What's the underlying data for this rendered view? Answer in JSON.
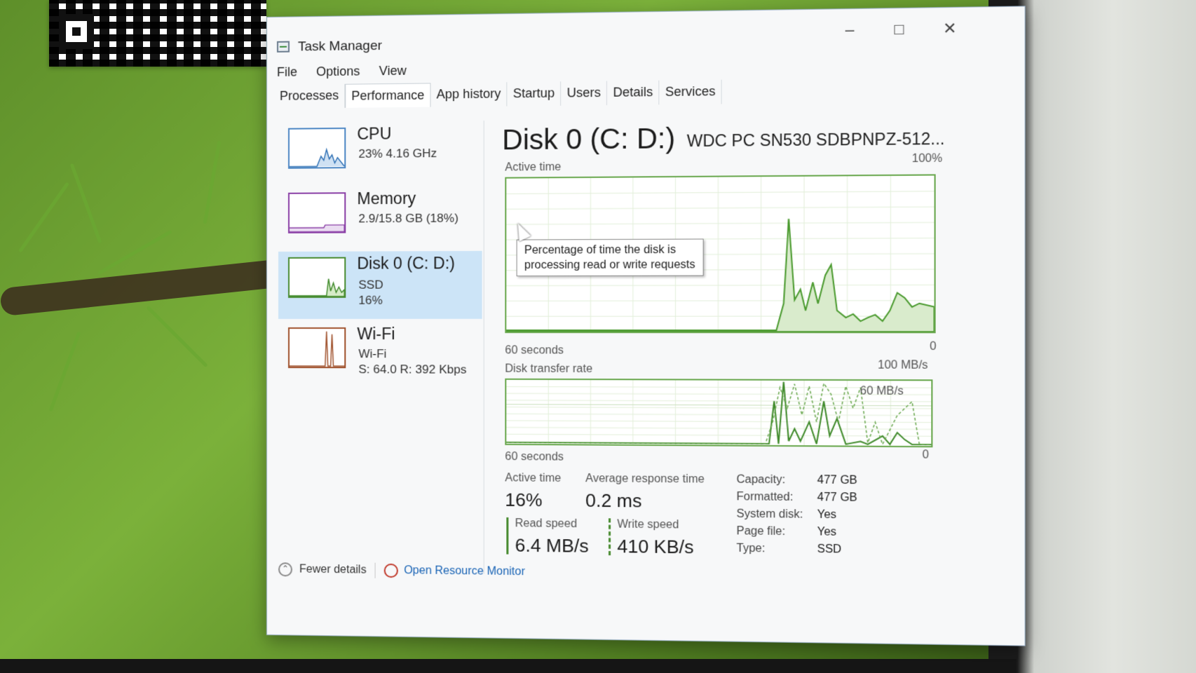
{
  "window": {
    "title": "Task Manager"
  },
  "menu": [
    "File",
    "Options",
    "View"
  ],
  "tabs": [
    "Processes",
    "Performance",
    "App history",
    "Startup",
    "Users",
    "Details",
    "Services"
  ],
  "sidebar": {
    "items": [
      {
        "title": "CPU",
        "line1": "23% 4.16 GHz",
        "line2": ""
      },
      {
        "title": "Memory",
        "line1": "2.9/15.8 GB (18%)",
        "line2": ""
      },
      {
        "title": "Disk 0 (C: D:)",
        "line1": "SSD",
        "line2": "16%"
      },
      {
        "title": "Wi-Fi",
        "line1": "Wi-Fi",
        "line2": "S: 64.0 R: 392 Kbps"
      }
    ]
  },
  "main": {
    "title": "Disk 0 (C: D:)",
    "model": "WDC PC SN530 SDBPNPZ-512...",
    "active_graph": {
      "label": "Active time",
      "max": "100%",
      "time": "60 seconds",
      "min": "0"
    },
    "tooltip": {
      "line1": "Percentage of time the disk is",
      "line2": "processing read or write requests"
    },
    "transfer_graph": {
      "label": "Disk transfer rate",
      "max": "100 MB/s",
      "mid": "60 MB/s",
      "time": "60 seconds",
      "min": "0"
    },
    "stats": {
      "active_time_label": "Active time",
      "active_time_value": "16%",
      "avg_response_label": "Average response time",
      "avg_response_value": "0.2 ms",
      "read_label": "Read speed",
      "read_value": "6.4 MB/s",
      "write_label": "Write speed",
      "write_value": "410 KB/s"
    },
    "properties": [
      {
        "label": "Capacity:",
        "value": "477 GB"
      },
      {
        "label": "Formatted:",
        "value": "477 GB"
      },
      {
        "label": "System disk:",
        "value": "Yes"
      },
      {
        "label": "Page file:",
        "value": "Yes"
      },
      {
        "label": "Type:",
        "value": "SSD"
      }
    ]
  },
  "footer": {
    "fewer_details": "Fewer details",
    "resource_monitor": "Open Resource Monitor"
  },
  "colors": {
    "accent_selected": "#cce4f7",
    "disk_green": "#6aa84f",
    "link": "#1a64b5"
  }
}
